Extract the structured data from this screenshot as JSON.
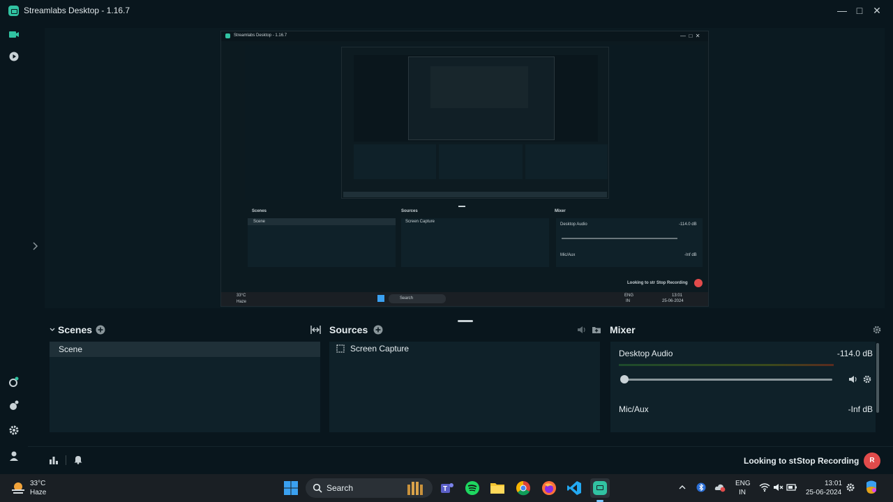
{
  "window": {
    "title": "Streamlabs Desktop - 1.16.7"
  },
  "scenes": {
    "header": "Scenes",
    "items": [
      "Scene"
    ]
  },
  "sources": {
    "header": "Sources",
    "items": [
      "Screen Capture"
    ]
  },
  "mixer": {
    "header": "Mixer",
    "channels": [
      {
        "name": "Desktop Audio",
        "level": "-114.0 dB"
      },
      {
        "name": "Mic/Aux",
        "level": "-Inf dB"
      }
    ]
  },
  "footer": {
    "status": "Looking to st",
    "stop_recording": "Stop Recording",
    "rec_badge": "R"
  },
  "preview": {
    "title": "Streamlabs Desktop - 1.16.7",
    "scenes_header": "Scenes",
    "sources_header": "Sources",
    "mixer_header": "Mixer",
    "scene_item": "Scene",
    "source_item": "Screen Capture",
    "desktop_audio": "Desktop Audio",
    "desktop_level": "-114.0 dB",
    "mic_aux": "Mic/Aux",
    "mic_level": "-Inf dB",
    "status": "Looking to str",
    "stop_recording": "Stop Recording",
    "weather_temp": "33°C",
    "weather_desc": "Haze",
    "search": "Search",
    "lang1": "ENG",
    "lang2": "IN",
    "time": "13:01",
    "date": "25-06-2024"
  },
  "taskbar": {
    "weather_temp": "33°C",
    "weather_desc": "Haze",
    "search_label": "Search",
    "lang_line1": "ENG",
    "lang_line2": "IN",
    "time": "13:01",
    "date": "25-06-2024"
  },
  "colors": {
    "accent": "#31c3a2",
    "record": "#e14b4b",
    "panel": "#0f2129",
    "background": "#09161d"
  }
}
